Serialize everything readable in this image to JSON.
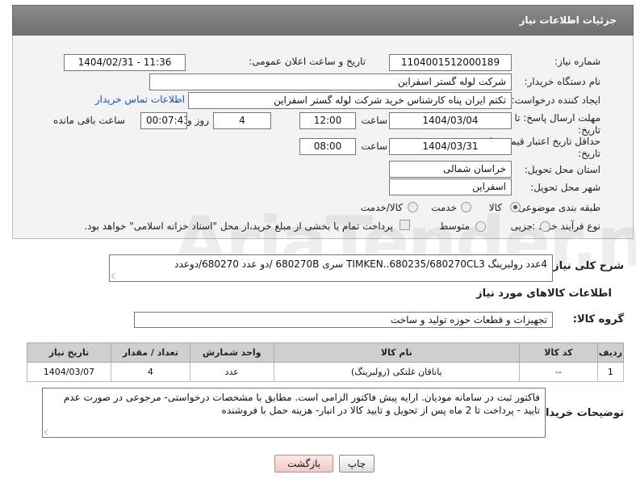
{
  "header": {
    "title": "جزئیات اطلاعات نیاز"
  },
  "fields": {
    "need_number_label": "شماره نیاز:",
    "need_number": "1104001512000189",
    "announce_label": "تاریخ و ساعت اعلان عمومی:",
    "announce_value": "1404/02/31 - 11:36",
    "buyer_org_label": "نام دستگاه خریدار:",
    "buyer_org": "شرکت لوله گستر اسفراین",
    "requester_label": "ایجاد کننده درخواست:",
    "requester": "تکتم ایران پناه کارشناس خرید شرکت لوله گستر اسفراین",
    "contact_link": "اطلاعات تماس خریدار",
    "deadline_label": "مهلت ارسال پاسخ: تا تاریخ:",
    "deadline_date": "1404/03/04",
    "time_label": "ساعت",
    "deadline_time": "12:00",
    "days_value": "4",
    "days_label": "روز و",
    "remaining_time": "00:07:43",
    "remaining_label": "ساعت باقی مانده",
    "validity_label": "حداقل تاریخ اعتبار قیمت: تا تاریخ:",
    "validity_date": "1404/03/31",
    "validity_time": "08:00",
    "province_label": "استان محل تحویل:",
    "province": "خراسان شمالی",
    "city_label": "شهر محل تحویل:",
    "city": "اسفراین",
    "category_label": "طبقه بندی موضوعی:",
    "category_options": [
      "کالا",
      "خدمت",
      "کالا/خدمت"
    ],
    "process_label": "نوع فرآیند خرید :",
    "process_options": [
      "جزیی",
      "متوسط"
    ],
    "payment_note": "پرداخت تمام یا بخشی از مبلغ خرید،از محل \"اسناد خزانه اسلامی\" خواهد بود."
  },
  "description": {
    "label": "شرح کلی نیاز:",
    "text": "4عدد رولبرینگ TIMKEN..680235/680270CL3 سری 680270B /دو عدد 680270/دوعدد"
  },
  "goods_info": {
    "title": "اطلاعات کالاهای مورد نیاز",
    "group_label": "گروه کالا:",
    "group_value": "تجهیزات و قطعات حوزه تولید و ساخت"
  },
  "table": {
    "headers": [
      "ردیف",
      "کد کالا",
      "نام کالا",
      "واحد شمارش",
      "تعداد / مقدار",
      "تاریخ نیاز"
    ],
    "rows": [
      [
        "1",
        "--",
        "یاتاقان غلتکی (رولبرینگ)",
        "عدد",
        "4",
        "1404/03/07"
      ]
    ]
  },
  "buyer_notes": {
    "label": "توضیحات خریدار:",
    "text": "فاکتور ثبت در سامانه مودیان. ارایه پیش فاکتور الزامی است. مطابق با مشخصات درخواستی- مرجوعی در صورت عدم تایید - پرداخت تا 2 ماه پس از تحویل و تایید کالا در انبار- هزینه حمل با فروشنده"
  },
  "buttons": {
    "print": "چاپ",
    "back": "بازگشت"
  }
}
